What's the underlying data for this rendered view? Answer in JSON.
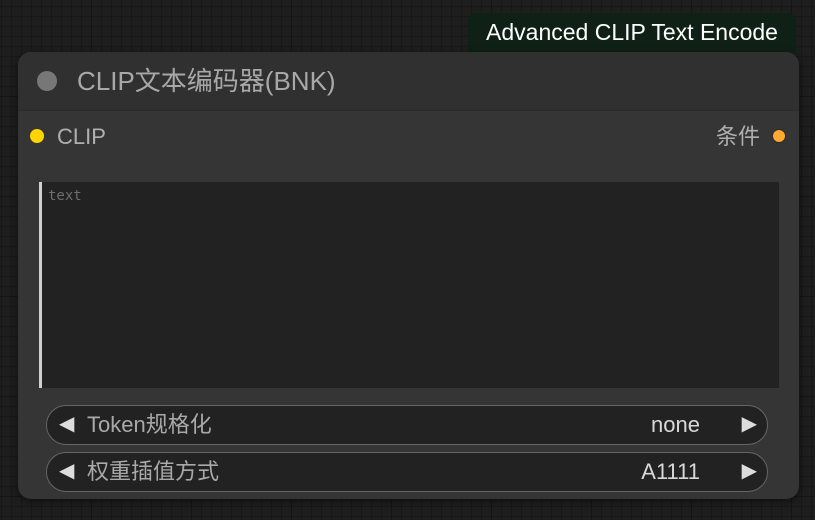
{
  "badge": {
    "text": "Advanced CLIP Text Encode"
  },
  "node": {
    "title": "CLIP文本编码器(BNK)",
    "input": {
      "label": "CLIP",
      "color": "#ffd500"
    },
    "output": {
      "label": "条件",
      "color": "#ffa931"
    },
    "text_widget": {
      "value": "",
      "placeholder": "text"
    },
    "widgets": [
      {
        "label": "Token规格化",
        "value": "none",
        "left_arrow": "◀",
        "right_arrow": "▶"
      },
      {
        "label": "权重插值方式",
        "value": "A1111",
        "left_arrow": "◀",
        "right_arrow": "▶"
      }
    ]
  },
  "colors": {
    "node_bg": "#353535",
    "header_bg": "#303030",
    "badge_bg": "#0f2016",
    "canvas_bg": "#1e1e1e"
  }
}
